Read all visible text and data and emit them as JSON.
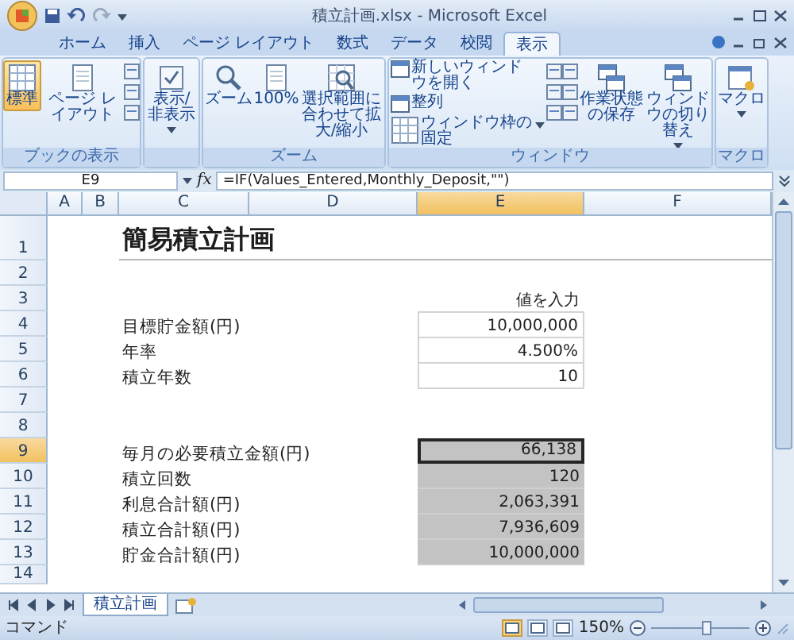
{
  "window": {
    "title": "積立計画.xlsx - Microsoft Excel"
  },
  "ribbon_tabs": [
    {
      "label": "ホーム",
      "selected": false
    },
    {
      "label": "挿入",
      "selected": false
    },
    {
      "label": "ページ レイアウト",
      "selected": false
    },
    {
      "label": "数式",
      "selected": false
    },
    {
      "label": "データ",
      "selected": false
    },
    {
      "label": "校閲",
      "selected": false
    },
    {
      "label": "表示",
      "selected": true
    }
  ],
  "ribbon_groups": [
    {
      "label": "ブックの表示",
      "items": [
        {
          "kind": "large",
          "label": "標準",
          "selected": true,
          "has_menu": false
        },
        {
          "kind": "large",
          "label": "ページ レイアウト",
          "selected": false,
          "has_menu": false
        }
      ]
    },
    {
      "items": [
        {
          "kind": "large",
          "label": "表示/非表示",
          "selected": false,
          "has_menu": true
        }
      ]
    },
    {
      "label": "ズーム",
      "items": [
        {
          "kind": "large",
          "label": "ズーム",
          "selected": false,
          "has_menu": false
        },
        {
          "kind": "large",
          "label": "100%",
          "selected": false,
          "has_menu": false
        },
        {
          "kind": "large",
          "label": "選択範囲に合わせて拡大/縮小",
          "selected": false,
          "has_menu": false
        }
      ]
    },
    {
      "label": "ウィンドウ",
      "items": [
        {
          "kind": "small",
          "label": "新しいウィンドウを開く",
          "selected": false,
          "has_menu": false
        },
        {
          "kind": "small",
          "label": "整列",
          "selected": false,
          "has_menu": false
        },
        {
          "kind": "small",
          "label": "ウィンドウ枠の固定",
          "selected": false,
          "has_menu": true
        },
        {
          "kind": "large",
          "label": "作業状態の保存",
          "selected": false,
          "has_menu": false
        },
        {
          "kind": "large",
          "label": "ウィンドウの切り替え",
          "selected": false,
          "has_menu": true
        }
      ]
    },
    {
      "label": "マクロ",
      "items": [
        {
          "kind": "large",
          "label": "マクロ",
          "selected": false,
          "has_menu": true
        }
      ]
    }
  ],
  "formula_bar": {
    "name_box": "E9",
    "function_label": "fx",
    "formula": "=IF(Values_Entered,Monthly_Deposit,\"\")"
  },
  "columns": [
    {
      "label": "A",
      "selected": false
    },
    {
      "label": "B",
      "selected": false
    },
    {
      "label": "C",
      "selected": false
    },
    {
      "label": "D",
      "selected": false
    },
    {
      "label": "E",
      "selected": true
    },
    {
      "label": "F",
      "selected": false
    }
  ],
  "rows": [
    {
      "header": "1",
      "selected": false,
      "kind": "title",
      "label": "簡易積立計画"
    },
    {
      "header": "2",
      "selected": false,
      "kind": "blank"
    },
    {
      "header": "3",
      "selected": false,
      "kind": "heading",
      "value": "値を入力"
    },
    {
      "header": "4",
      "selected": false,
      "kind": "input",
      "label": "目標貯金額(円)",
      "value": "10,000,000"
    },
    {
      "header": "5",
      "selected": false,
      "kind": "input",
      "label": "年率",
      "value": "4.500%"
    },
    {
      "header": "6",
      "selected": false,
      "kind": "input",
      "label": "積立年数",
      "value": "10"
    },
    {
      "header": "7",
      "selected": false,
      "kind": "blank"
    },
    {
      "header": "8",
      "selected": false,
      "kind": "blank"
    },
    {
      "header": "9",
      "selected": true,
      "kind": "output",
      "label": "毎月の必要積立金額(円)",
      "value": "66,138"
    },
    {
      "header": "10",
      "selected": false,
      "kind": "output",
      "label": "積立回数",
      "value": "120"
    },
    {
      "header": "11",
      "selected": false,
      "kind": "output",
      "label": "利息合計額(円)",
      "value": "2,063,391"
    },
    {
      "header": "12",
      "selected": false,
      "kind": "output",
      "label": "積立合計額(円)",
      "value": "7,936,609"
    },
    {
      "header": "13",
      "selected": false,
      "kind": "output",
      "label": "貯金合計額(円)",
      "value": "10,000,000"
    },
    {
      "header": "14",
      "selected": false,
      "kind": "blank"
    }
  ],
  "sheet_tabs": [
    {
      "label": "積立計画",
      "selected": true
    }
  ],
  "status_bar": {
    "mode": "コマンド",
    "views": [
      {
        "selected": true
      },
      {
        "selected": false
      },
      {
        "selected": false
      }
    ],
    "zoom": "150%",
    "zoom_slider": {
      "level": 0.56
    }
  }
}
